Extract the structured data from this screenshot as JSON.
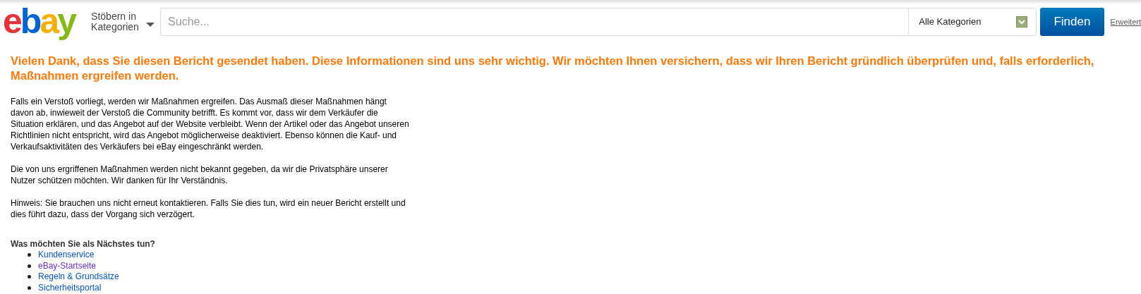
{
  "header": {
    "logo_letters": [
      {
        "text": "e",
        "color": "#e53238"
      },
      {
        "text": "b",
        "color": "#0064d2"
      },
      {
        "text": "a",
        "color": "#f5af02"
      },
      {
        "text": "y",
        "color": "#86b817"
      }
    ],
    "browse_label": "Stöbern in Kategorien",
    "search": {
      "placeholder": "Suche..."
    },
    "category_select": {
      "value": "Alle Kategorien"
    },
    "search_button": "Finden",
    "advanced_link": "Erweitert"
  },
  "main": {
    "heading": "Vielen Dank, dass Sie diesen Bericht gesendet haben. Diese Informationen sind uns sehr wichtig. Wir möchten Ihnen versichern, dass wir Ihren Bericht gründlich überprüfen und, falls erforderlich, Maßnahmen ergreifen werden.",
    "paragraphs": [
      "Falls ein Verstoß vorliegt, werden wir Maßnahmen ergreifen. Das Ausmaß dieser Maßnahmen hängt davon ab, inwieweit der Verstoß die Community betrifft. Es kommt vor, dass wir dem Verkäufer die Situation erklären, und das Angebot auf der Website verbleibt. Wenn der Artikel oder das Angebot unseren Richtlinien nicht entspricht, wird das Angebot möglicherweise deaktiviert. Ebenso können die Kauf- und Verkaufsaktivitäten des Verkäufers bei eBay eingeschränkt werden.",
      "Die von uns ergriffenen Maßnahmen werden nicht bekannt gegeben, da wir die Privatsphäre unserer Nutzer schützen möchten. Wir danken für Ihr Verständnis.",
      "Hinweis: Sie brauchen uns nicht erneut kontaktieren. Falls Sie dies tun, wird ein neuer Bericht erstellt und dies führt dazu, dass der Vorgang sich verzögert."
    ],
    "next_heading": "Was möchten Sie als Nächstes tun?",
    "links": [
      {
        "label": "Kundenservice",
        "visited": false
      },
      {
        "label": "eBay-Startseite",
        "visited": true
      },
      {
        "label": "Regeln & Grundsätze",
        "visited": false
      },
      {
        "label": "Sicherheitsportal",
        "visited": false
      }
    ]
  }
}
